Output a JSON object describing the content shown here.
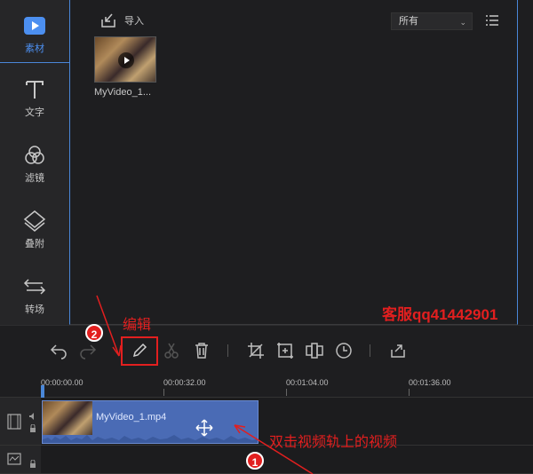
{
  "sidebar": {
    "items": [
      {
        "label": "素材",
        "icon": "media-icon",
        "active": true
      },
      {
        "label": "文字",
        "icon": "text-icon"
      },
      {
        "label": "滤镜",
        "icon": "filter-icon"
      },
      {
        "label": "叠附",
        "icon": "overlay-icon"
      },
      {
        "label": "转场",
        "icon": "transition-icon"
      }
    ]
  },
  "media": {
    "import_label": "导入",
    "filter_value": "所有",
    "items": [
      {
        "name": "MyVideo_1..."
      }
    ]
  },
  "watermark": "客服qq41442901",
  "toolbar": {
    "tools": [
      "undo-icon",
      "redo-icon",
      "edit-icon",
      "cut-icon",
      "delete-icon",
      "crop-icon",
      "zoom-icon",
      "mosaic-icon",
      "speed-icon",
      "export-icon"
    ]
  },
  "annotations": {
    "edit_label": "编辑",
    "step1": "1",
    "step2": "2",
    "instruction": "双击视频轨上的视频"
  },
  "timeline": {
    "ticks": [
      "00:00:00.00",
      "00:00:32.00",
      "00:01:04.00",
      "00:01:36.00"
    ],
    "clip_name": "MyVideo_1.mp4"
  },
  "colors": {
    "accent": "#4a87d8",
    "clip": "#4a6bb5",
    "annotation": "#e21f1f"
  }
}
